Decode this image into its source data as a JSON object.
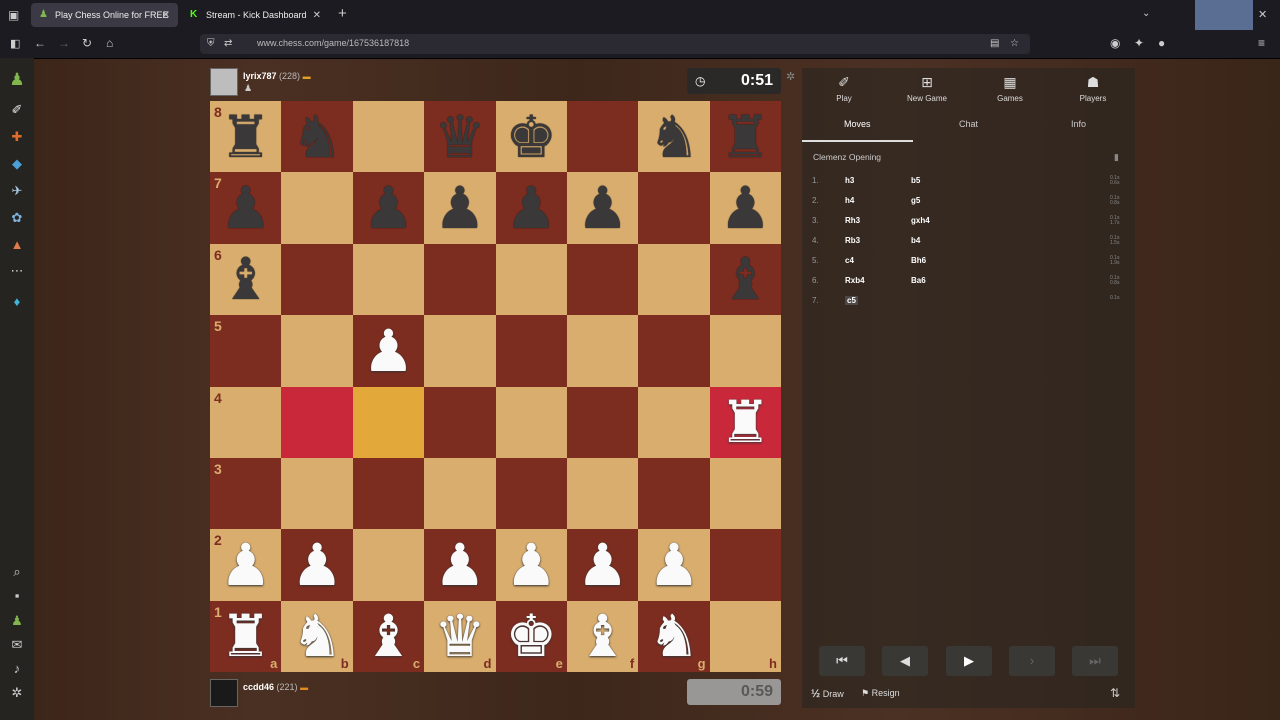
{
  "browser": {
    "tabs": [
      {
        "title": "Play Chess Online for FREE",
        "active": true
      },
      {
        "title": "Stream - Kick Dashboard",
        "active": false
      }
    ],
    "url": "www.chess.com/game/167536187818"
  },
  "top_player": {
    "name": "lyrix787",
    "rating": "(228)",
    "clock": "0:51"
  },
  "bottom_player": {
    "name": "ccdd46",
    "rating": "(221)",
    "clock": "0:59"
  },
  "board": {
    "files": [
      "a",
      "b",
      "c",
      "d",
      "e",
      "f",
      "g",
      "h"
    ],
    "ranks": [
      "8",
      "7",
      "6",
      "5",
      "4",
      "3",
      "2",
      "1"
    ],
    "rows": [
      [
        "br",
        "bn",
        "",
        "bq",
        "bk",
        "",
        "bn",
        "br"
      ],
      [
        "bp",
        "",
        "bp",
        "bp",
        "bp",
        "bp",
        "",
        "bp"
      ],
      [
        "bb",
        "",
        "",
        "",
        "",
        "",
        "",
        "bb"
      ],
      [
        "",
        "",
        "wp",
        "",
        "",
        "",
        "",
        ""
      ],
      [
        "",
        "",
        "",
        "",
        "",
        "",
        "",
        "wr"
      ],
      [
        "",
        "",
        "",
        "",
        "",
        "",
        "",
        ""
      ],
      [
        "wp",
        "wp",
        "",
        "wp",
        "wp",
        "wp",
        "wp",
        ""
      ],
      [
        "wr",
        "wn",
        "wb",
        "wq",
        "wk",
        "wb",
        "wn",
        ""
      ]
    ],
    "highlights": {
      "b4": "red",
      "h4": "red",
      "c4": "yellow"
    }
  },
  "panel": {
    "tabs": [
      {
        "icon": "play-icon",
        "label": "Play"
      },
      {
        "icon": "new-game-icon",
        "label": "New Game"
      },
      {
        "icon": "games-icon",
        "label": "Games"
      },
      {
        "icon": "players-icon",
        "label": "Players"
      }
    ],
    "subtabs": [
      "Moves",
      "Chat",
      "Info"
    ],
    "opening": "Clemenz Opening",
    "moves": [
      {
        "num": "1.",
        "white": "h3",
        "black": "b5"
      },
      {
        "num": "2.",
        "white": "h4",
        "black": "g5"
      },
      {
        "num": "3.",
        "white": "Rh3",
        "black": "gxh4"
      },
      {
        "num": "4.",
        "white": "Rb3",
        "black": "b4"
      },
      {
        "num": "5.",
        "white": "c4",
        "black": "Bh6"
      },
      {
        "num": "6.",
        "white": "Rxb4",
        "black": "Ba6"
      },
      {
        "num": "7.",
        "white": "c5",
        "black": ""
      }
    ],
    "move_times": [
      [
        "0.1s",
        "0.6s"
      ],
      [
        "0.1s",
        "0.8s"
      ],
      [
        "0.1s",
        "1.7s"
      ],
      [
        "0.1s",
        "1.5s"
      ],
      [
        "0.1s",
        "1.9s"
      ],
      [
        "0.1s",
        "0.8s"
      ],
      [
        "0.1s",
        ""
      ]
    ],
    "actions": {
      "draw": "Draw",
      "draw_icon": "½",
      "resign": "Resign"
    }
  }
}
